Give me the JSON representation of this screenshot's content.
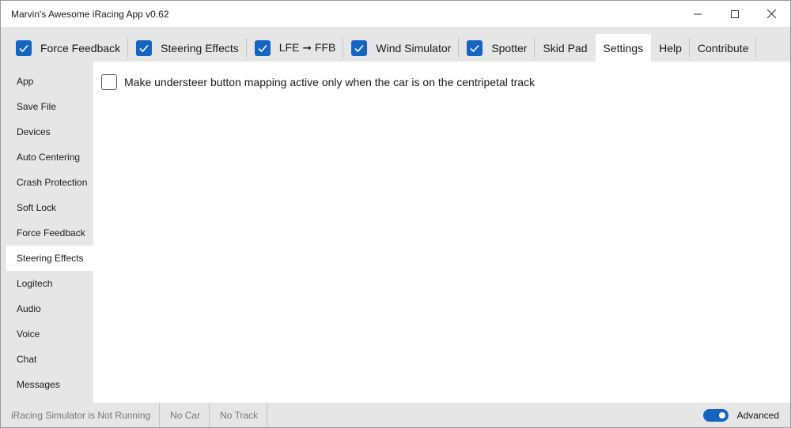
{
  "window": {
    "title": "Marvin's Awesome iRacing App v0.62"
  },
  "tabs": [
    {
      "label": "Force Feedback",
      "checked": true
    },
    {
      "label": "Steering Effects",
      "checked": true
    },
    {
      "label": "LFE ➞ FFB",
      "checked": true
    },
    {
      "label": "Wind Simulator",
      "checked": true
    },
    {
      "label": "Spotter",
      "checked": true
    },
    {
      "label": "Skid Pad"
    },
    {
      "label": "Settings",
      "active": true
    },
    {
      "label": "Help"
    },
    {
      "label": "Contribute"
    }
  ],
  "sidebar": {
    "items": [
      {
        "label": "App"
      },
      {
        "label": "Save File"
      },
      {
        "label": "Devices"
      },
      {
        "label": "Auto Centering"
      },
      {
        "label": "Crash Protection"
      },
      {
        "label": "Soft Lock"
      },
      {
        "label": "Force Feedback"
      },
      {
        "label": "Steering Effects",
        "active": true
      },
      {
        "label": "Logitech"
      },
      {
        "label": "Audio"
      },
      {
        "label": "Voice"
      },
      {
        "label": "Chat"
      },
      {
        "label": "Messages"
      }
    ]
  },
  "content": {
    "option_label": "Make understeer button mapping active only when the car is on the centripetal track",
    "option_checked": false
  },
  "status": {
    "sim_status": "iRacing Simulator is Not Running",
    "car": "No Car",
    "track": "No Track",
    "advanced_label": "Advanced",
    "advanced_on": true
  },
  "colors": {
    "accent": "#1565c0"
  }
}
